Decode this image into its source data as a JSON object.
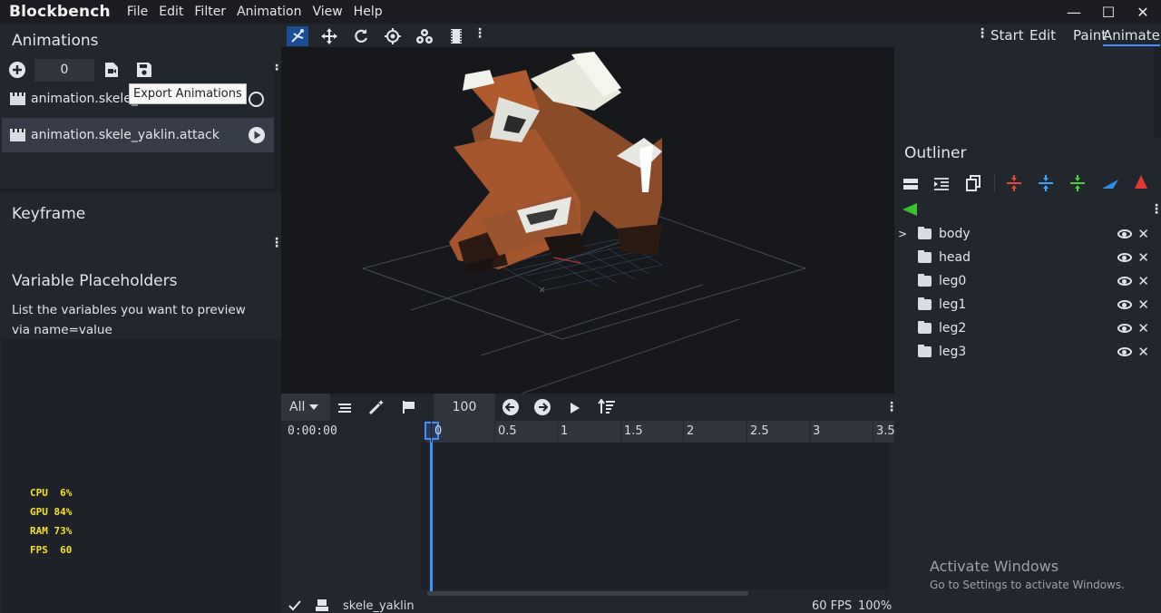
{
  "app": {
    "title": "Blockbench"
  },
  "menu": [
    "File",
    "Edit",
    "Filter",
    "Animation",
    "View",
    "Help"
  ],
  "window_controls": {
    "minimize": "—",
    "maximize": "☐",
    "close": "✕"
  },
  "modes": [
    "Start",
    "Edit",
    "Paint",
    "Animate"
  ],
  "active_mode": "Animate",
  "animations_panel": {
    "title": "Animations",
    "number_value": "0",
    "tooltip": "Export Animations",
    "items": [
      {
        "label": "animation.skele_"
      },
      {
        "label": "animation.skele_yaklin.attack"
      }
    ]
  },
  "keyframe_panel": {
    "title": "Keyframe"
  },
  "variables_panel": {
    "title": "Variable Placeholders",
    "description": "List the variables you want to preview via name=value"
  },
  "performance": [
    {
      "label": "CPU",
      "value": "6%"
    },
    {
      "label": "GPU",
      "value": "84%"
    },
    {
      "label": "RAM",
      "value": "73%"
    },
    {
      "label": "FPS",
      "value": "60"
    }
  ],
  "timeline": {
    "filter": "All",
    "speed": "100",
    "time": "0:00:00",
    "ticks": [
      "0",
      "0.5",
      "1",
      "1.5",
      "2",
      "2.5",
      "3",
      "3.5"
    ]
  },
  "outliner": {
    "title": "Outliner",
    "items": [
      {
        "label": "body"
      },
      {
        "label": "head"
      },
      {
        "label": "leg0"
      },
      {
        "label": "leg1"
      },
      {
        "label": "leg2"
      },
      {
        "label": "leg3"
      }
    ]
  },
  "status_bar": {
    "model": "skele_yaklin",
    "fps": "60 FPS",
    "zoom": "100%"
  },
  "watermark": {
    "title": "Activate Windows",
    "subtitle": "Go to Settings to activate Windows."
  },
  "colors": {
    "accent": "#3e90ff",
    "panel": "#22262d",
    "background": "#1e2127",
    "viewport": "#16181c",
    "perf_text": "#f4e12a"
  }
}
